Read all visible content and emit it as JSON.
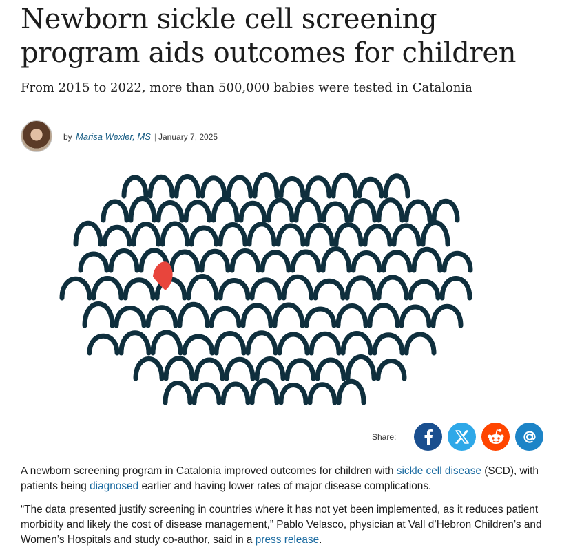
{
  "article": {
    "headline": "Newborn sickle cell screening program aids outcomes for children",
    "subheadline": "From 2015 to 2022, more than 500,000 babies were tested in Catalonia",
    "byline": {
      "prefix": "by",
      "author": "Marisa Wexler, MS",
      "separator": "|",
      "date": "January 7, 2025"
    },
    "share": {
      "label": "Share:",
      "buttons": [
        {
          "name": "facebook",
          "icon": "facebook-icon",
          "color": "#1a4f8f"
        },
        {
          "name": "x",
          "icon": "x-icon",
          "color": "#2ea8e8"
        },
        {
          "name": "reddit",
          "icon": "reddit-icon",
          "color": "#ff4500"
        },
        {
          "name": "email",
          "icon": "at-icon",
          "color": "#1d84c7"
        }
      ]
    },
    "paragraph1": {
      "text_a": "A newborn screening program in Catalonia improved outcomes for children with ",
      "link1": "sickle cell disease",
      "text_b": " (SCD), with patients being ",
      "link2": "diagnosed",
      "text_c": " earlier and having lower rates of major disease complications."
    },
    "paragraph2": {
      "text_a": "“The data presented justify screening in countries where it has not yet been implemented, as it reduces patient morbidity and likely the cost of disease management,” Pablo Velasco, physician at Vall d’Hebron Children’s and Women’s Hospitals and study co-author, said in a ",
      "link": "press release",
      "text_b": "."
    },
    "hero_colors": {
      "outline": "#0f2f3d",
      "highlight": "#e8453c"
    }
  }
}
